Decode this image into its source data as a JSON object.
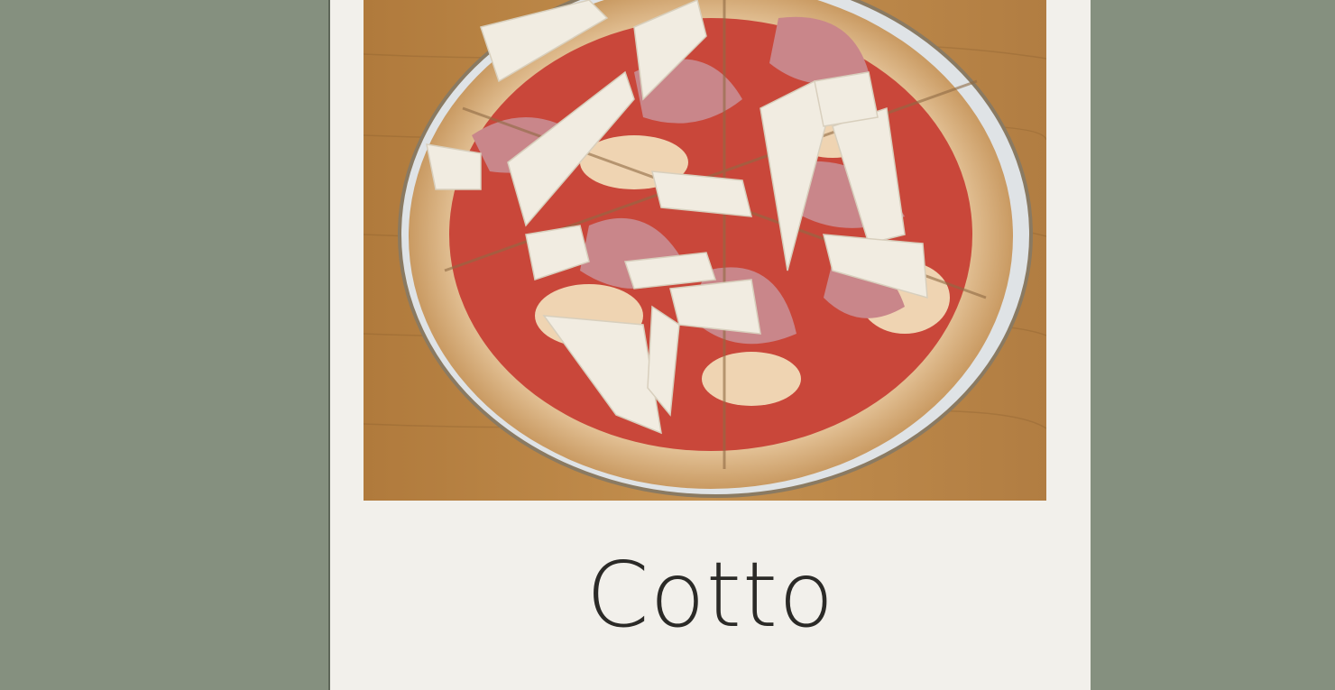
{
  "background_color": "#85907f",
  "card": {
    "background_color": "#f2f0eb",
    "photo": {
      "subject": "pizza-cotto-with-ham-and-shaved-cheese",
      "table_color": "#b98746",
      "plate_color": "#dfe3e6",
      "crust_color": "#d9b488",
      "sauce_color": "#c9473a",
      "ham_color": "#c9868a",
      "cheese_color": "#f1ece1"
    },
    "title": "Cotto",
    "title_color": "#2b2a27"
  }
}
